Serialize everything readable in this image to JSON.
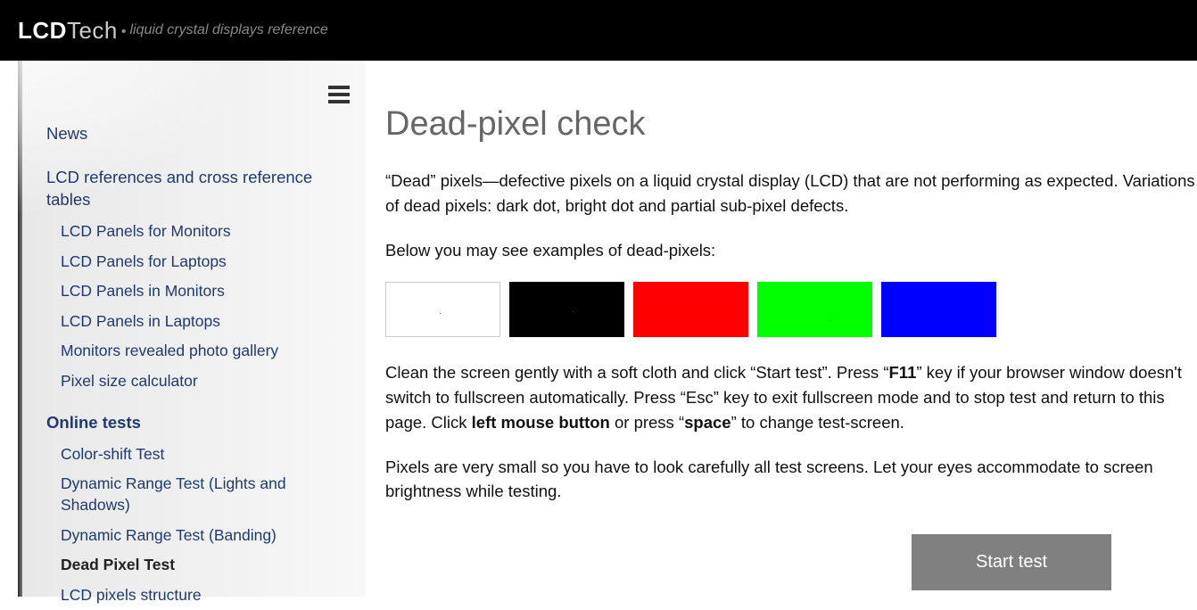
{
  "header": {
    "logo_bold": "LCD",
    "logo_light": "Tech",
    "tagline": "liquid crystal displays reference"
  },
  "sidebar": {
    "top_items": [
      "News",
      "LCD references and cross reference tables"
    ],
    "ref_sub": [
      "LCD Panels for Monitors",
      "LCD Panels for Laptops",
      "LCD Panels in Monitors",
      "LCD Panels in Laptops",
      "Monitors revealed photo gallery",
      "Pixel size calculator"
    ],
    "tests_header": "Online tests",
    "tests_sub": [
      "Color-shift Test",
      "Dynamic Range Test (Lights and Shadows)",
      "Dynamic Range Test (Banding)",
      "Dead Pixel Test",
      "LCD pixels structure"
    ],
    "active_test": "Dead Pixel Test"
  },
  "content": {
    "title": "Dead-pixel check",
    "p1": "“Dead” pixels—defective pixels on a liquid crystal display (LCD) that are not performing as expected. Variations of dead pixels: dark dot, bright dot and partial sub-pixel defects.",
    "p2": "Below you may see examples of dead-pixels:",
    "p3_a": "Clean the screen gently with a soft cloth and click “Start test”. Press “",
    "p3_b": "F11",
    "p3_c": "” key if your browser window doesn't switch to fullscreen automatically. Press “Esc” key to exit fullscreen mode and to stop test and return to this page. Click ",
    "p3_d": "left mouse button",
    "p3_e": " or press “",
    "p3_f": "space",
    "p3_g": "” to change test-screen.",
    "p4": "Pixels are very small so you have to look carefully all test screens. Let your eyes accommodate to screen brightness while testing.",
    "button": "Start test",
    "swatch_colors": [
      "#ffffff",
      "#000000",
      "#ff0000",
      "#00ff00",
      "#0000ff"
    ]
  }
}
